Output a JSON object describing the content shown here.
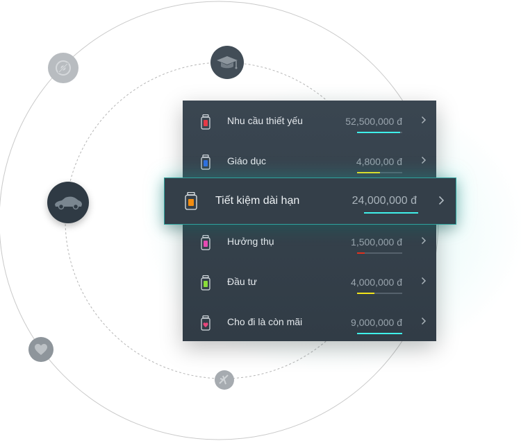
{
  "colors": {
    "panel": "#36424c",
    "accent": "#3ff0ea",
    "text": "#e6eaee",
    "muted": "#9aa5ae"
  },
  "orbit_icons": [
    {
      "name": "disc-icon"
    },
    {
      "name": "graduation-cap-icon"
    },
    {
      "name": "car-icon"
    },
    {
      "name": "heart-icon"
    },
    {
      "name": "airplane-icon"
    }
  ],
  "jars": [
    {
      "label": "Nhu cầu thiết yếu",
      "amount": "52,500,000 đ",
      "jar_color": "#e53946",
      "bar_color": "#3ff0ea",
      "progress": 0.95
    },
    {
      "label": "Giáo dục",
      "amount": "4,800,00 đ",
      "jar_color": "#2f6fe0",
      "bar_color": "#f2e31a",
      "progress": 0.5
    },
    {
      "label": "Hưởng thụ",
      "amount": "1,500,000 đ",
      "jar_color": "#e84bb3",
      "bar_color": "#e2321e",
      "progress": 0.17
    },
    {
      "label": "Đầu tư",
      "amount": "4,000,000 đ",
      "jar_color": "#8bdc3a",
      "bar_color": "#f2e31a",
      "progress": 0.38
    },
    {
      "label": "Cho đi là còn mãi",
      "amount": "9,000,000 đ",
      "jar_color": "#e8457a",
      "bar_color": "#3ff0ea",
      "progress": 1.0
    }
  ],
  "selected_jar": {
    "label": "Tiết kiệm dài hạn",
    "amount": "24,000,000 đ",
    "jar_color": "#f28c10",
    "progress": 1.0
  }
}
